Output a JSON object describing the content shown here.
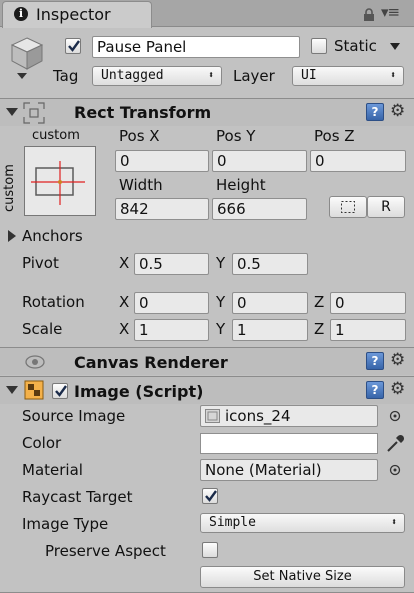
{
  "tab": {
    "title": "Inspector",
    "info_glyph": "i",
    "menu_glyph": "▾≡"
  },
  "gameobject": {
    "active": true,
    "name": "Pause Panel",
    "static_label": "Static",
    "static_checked": false,
    "tag_label": "Tag",
    "tag_value": "Untagged",
    "layer_label": "Layer",
    "layer_value": "UI"
  },
  "rect_transform": {
    "title": "Rect Transform",
    "anchor_label_top": "custom",
    "anchor_label_side": "custom",
    "pos_x_label": "Pos X",
    "pos_y_label": "Pos Y",
    "pos_z_label": "Pos Z",
    "pos_x": "0",
    "pos_y": "0",
    "pos_z": "0",
    "width_label": "Width",
    "height_label": "Height",
    "width": "842",
    "height": "666",
    "raw_button_label": "R",
    "anchors_label": "Anchors",
    "pivot_label": "Pivot",
    "pivot_x": "0.5",
    "pivot_y": "0.5",
    "rotation_label": "Rotation",
    "rotation_x": "0",
    "rotation_y": "0",
    "rotation_z": "0",
    "scale_label": "Scale",
    "scale_x": "1",
    "scale_y": "1",
    "scale_z": "1",
    "axis_x": "X",
    "axis_y": "Y",
    "axis_z": "Z"
  },
  "canvas_renderer": {
    "title": "Canvas Renderer"
  },
  "image_script": {
    "title": "Image (Script)",
    "enabled": true,
    "source_image_label": "Source Image",
    "source_image_value": "icons_24",
    "color_label": "Color",
    "color_value": "#ffffff",
    "material_label": "Material",
    "material_value": "None (Material)",
    "raycast_label": "Raycast Target",
    "raycast_checked": true,
    "image_type_label": "Image Type",
    "image_type_value": "Simple",
    "preserve_label": "Preserve Aspect",
    "preserve_checked": false,
    "set_native_label": "Set Native Size"
  },
  "icons": [
    "info-icon",
    "lock-icon",
    "menu-icon",
    "cube-icon",
    "help-icon",
    "gear-icon",
    "rect-transform-icon",
    "canvas-renderer-icon",
    "image-icon",
    "eyedropper-icon",
    "object-picker-icon",
    "blueprint-icon"
  ],
  "colors": {
    "panel_bg": "#c2c2c2",
    "header_bg": "#bdbdbd",
    "help_blue": "#3764a8",
    "anchor_red": "#e02020"
  }
}
